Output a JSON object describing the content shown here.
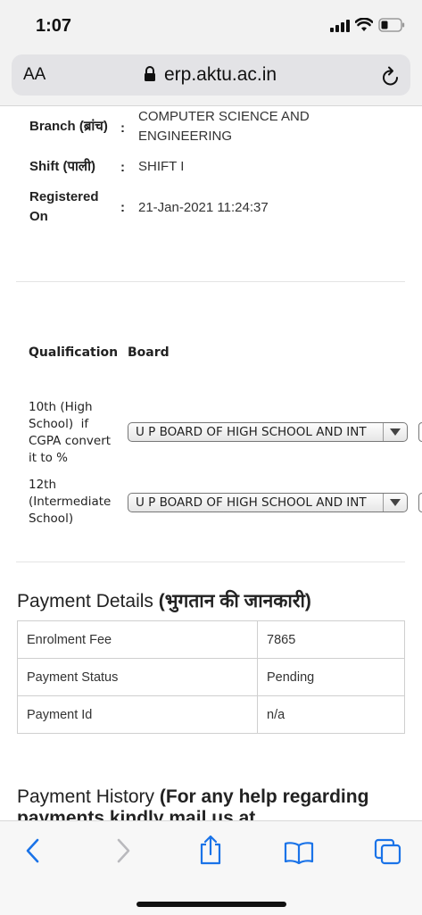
{
  "status_bar": {
    "time": "1:07"
  },
  "address_bar": {
    "aa": "AA",
    "url": "erp.aktu.ac.in"
  },
  "details": {
    "branch_label": "Branch (ब्रांच)",
    "branch_value_1": "COMPUTER SCIENCE AND",
    "branch_value_2": "ENGINEERING",
    "shift_label": "Shift (पाली)",
    "shift_value": "SHIFT I",
    "registered_label_1": "Registered",
    "registered_label_2": "On",
    "registered_value": "21-Jan-2021 11:24:37",
    "colon": ":"
  },
  "qualification": {
    "headers": [
      "Qualification",
      "Board"
    ],
    "rows": [
      {
        "lines": [
          "10th (High",
          "School)  if",
          "CGPA convert",
          "it to %"
        ],
        "board": "U P BOARD OF HIGH SCHOOL AND INT"
      },
      {
        "lines": [
          "12th",
          "(Intermediate",
          "School)"
        ],
        "board": "U P BOARD OF HIGH SCHOOL AND INT"
      }
    ]
  },
  "payment_details": {
    "title_plain": "Payment Details ",
    "title_bold": "(भुगतान की जानकारी)",
    "rows": [
      {
        "label": "Enrolment Fee",
        "value": "7865"
      },
      {
        "label": "Payment Status",
        "value": "Pending"
      },
      {
        "label": "Payment Id",
        "value": "n/a"
      }
    ]
  },
  "payment_history": {
    "title_plain": "Payment History ",
    "title_bold": "(For any help regarding",
    "title_bold_2": "payments kindly mail us at"
  },
  "icons": {
    "status": [
      "cellular-signal-icon",
      "wifi-icon",
      "battery-icon"
    ],
    "address": [
      "lock-icon",
      "reload-icon"
    ],
    "toolbar": [
      "back-icon",
      "forward-icon",
      "share-icon",
      "bookmarks-icon",
      "tabs-icon"
    ]
  }
}
